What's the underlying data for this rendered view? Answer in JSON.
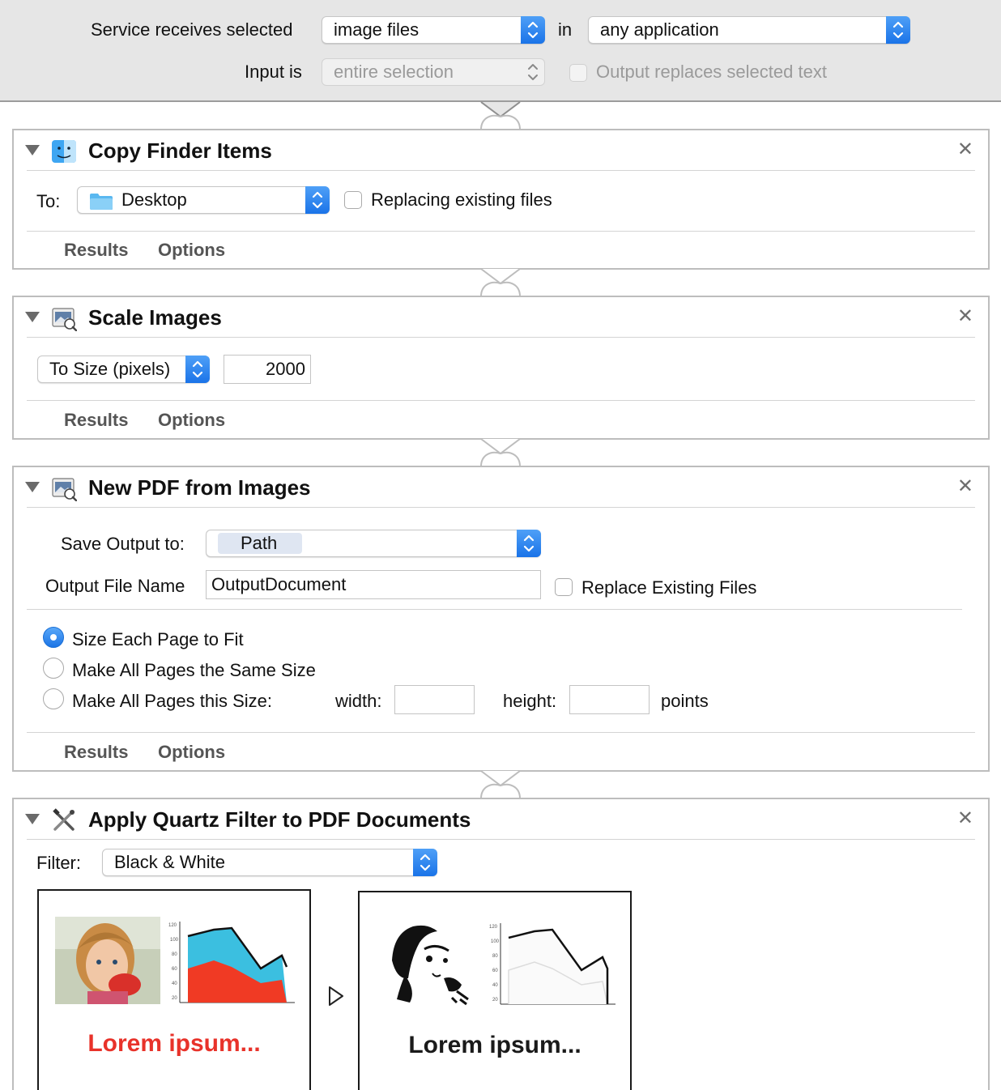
{
  "header": {
    "service_label": "Service receives selected",
    "service_value": "image files",
    "in_label": "in",
    "app_value": "any application",
    "input_label": "Input is",
    "input_value": "entire selection",
    "output_replaces_label": "Output replaces selected text"
  },
  "actions": [
    {
      "title": "Copy Finder Items",
      "icon": "finder-icon",
      "to_label": "To:",
      "to_value": "Desktop",
      "replacing_label": "Replacing existing files",
      "tabs": [
        "Results",
        "Options"
      ]
    },
    {
      "title": "Scale Images",
      "icon": "preview-icon",
      "mode_value": "To Size (pixels)",
      "size_value": "2000",
      "tabs": [
        "Results",
        "Options"
      ]
    },
    {
      "title": "New PDF from Images",
      "icon": "preview-icon",
      "save_output_label": "Save Output to:",
      "save_output_value": "Path",
      "output_file_label": "Output File Name",
      "output_file_value": "OutputDocument",
      "replace_existing_label": "Replace Existing Files",
      "radio_options": [
        "Size Each Page to Fit",
        "Make All Pages the Same Size",
        "Make All Pages this Size:"
      ],
      "selected_radio": 0,
      "width_label": "width:",
      "height_label": "height:",
      "points_label": "points",
      "tabs": [
        "Results",
        "Options"
      ]
    },
    {
      "title": "Apply Quartz Filter to PDF Documents",
      "icon": "tools-icon",
      "filter_label": "Filter:",
      "filter_value": "Black & White",
      "preview_before_text": "Lorem ipsum...",
      "preview_after_text": "Lorem ipsum..."
    }
  ],
  "colors": {
    "accent_blue": "#1a73e8",
    "chart_cyan": "#3bbfe0",
    "chart_red": "#f03a24",
    "preview_red_text": "#e8322a"
  }
}
